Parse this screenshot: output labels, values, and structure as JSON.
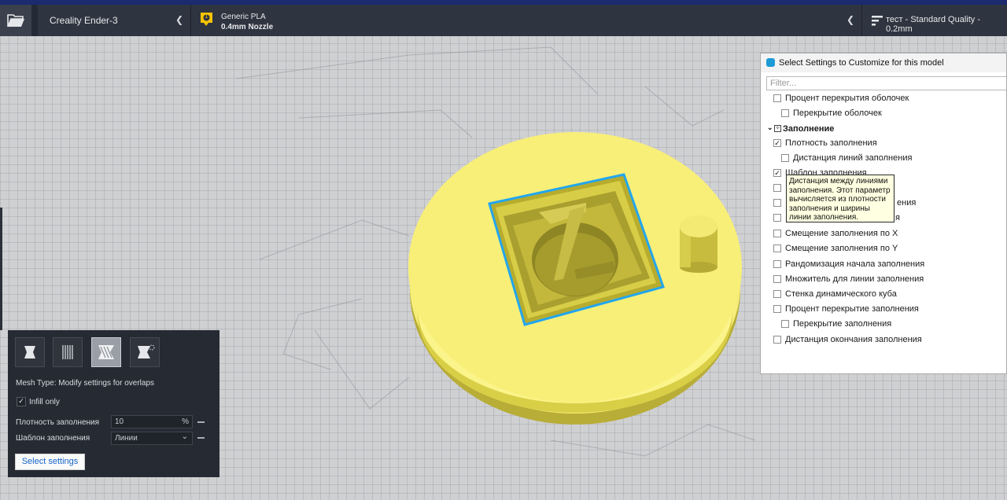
{
  "topbar": {
    "printer": "Creality Ender-3",
    "material_name": "Generic PLA",
    "nozzle": "0.4mm Nozzle",
    "material_badge": "1",
    "profile": "тест - Standard Quality - 0.2mm",
    "icons": [
      "folder-open-icon",
      "chevron-left-icon",
      "material-badge-icon",
      "settings-sliders-icon"
    ]
  },
  "dialog": {
    "title": "Select Settings to Customize for this model",
    "filter_placeholder": "Filter...",
    "items": [
      {
        "label": "Процент перекрытия оболочек",
        "checked": false,
        "indent": 1
      },
      {
        "label": "Перекрытие оболочек",
        "checked": false,
        "indent": 2
      },
      {
        "label": "Заполнение",
        "category": true
      },
      {
        "label": "Плотность заполнения",
        "checked": true,
        "indent": 1
      },
      {
        "label": "Дистанция линий заполнения",
        "checked": false,
        "indent": 2
      },
      {
        "label": "Шаблон заполнения",
        "checked": true,
        "indent": 1
      },
      {
        "label": "",
        "checked": false,
        "indent": 1
      },
      {
        "label": "ения",
        "checked": false,
        "indent": 1
      },
      {
        "label": "я",
        "checked": false,
        "indent": 1
      },
      {
        "label": "Смещение заполнения по X",
        "checked": false,
        "indent": 1
      },
      {
        "label": "Смещение заполнения по Y",
        "checked": false,
        "indent": 1
      },
      {
        "label": "Рандомизация начала заполнения",
        "checked": false,
        "indent": 1
      },
      {
        "label": "Множитель для линии заполнения",
        "checked": false,
        "indent": 1
      },
      {
        "label": "Стенка динамического куба",
        "checked": false,
        "indent": 1
      },
      {
        "label": "Процент перекрытие заполнения",
        "checked": false,
        "indent": 1
      },
      {
        "label": "Перекрытие заполнения",
        "checked": false,
        "indent": 2
      },
      {
        "label": "Дистанция окончания заполнения",
        "checked": false,
        "indent": 1
      }
    ],
    "tooltip": "Дистанция между линиями заполнения. Этот параметр вычисляется из плотности заполнения и ширины линии заполнения."
  },
  "model_panel": {
    "mesh_type": "Mesh Type: Modify settings for overlaps",
    "infill_only_label": "Infill only",
    "infill_only_checked": true,
    "density_label": "Плотность заполнения",
    "density_value": "10",
    "density_unit": "%",
    "pattern_label": "Шаблон заполнения",
    "pattern_value": "Линии",
    "select_settings": "Select settings",
    "tool_icons": [
      "normal-model-icon",
      "support-mesh-icon",
      "overlap-modify-icon",
      "anti-overhang-icon"
    ],
    "active_tool": 2
  },
  "colors": {
    "model": "#f8ef78",
    "model_shade": "#d6cc4a",
    "selection": "#22a6ee",
    "topbar": "#242a35"
  }
}
